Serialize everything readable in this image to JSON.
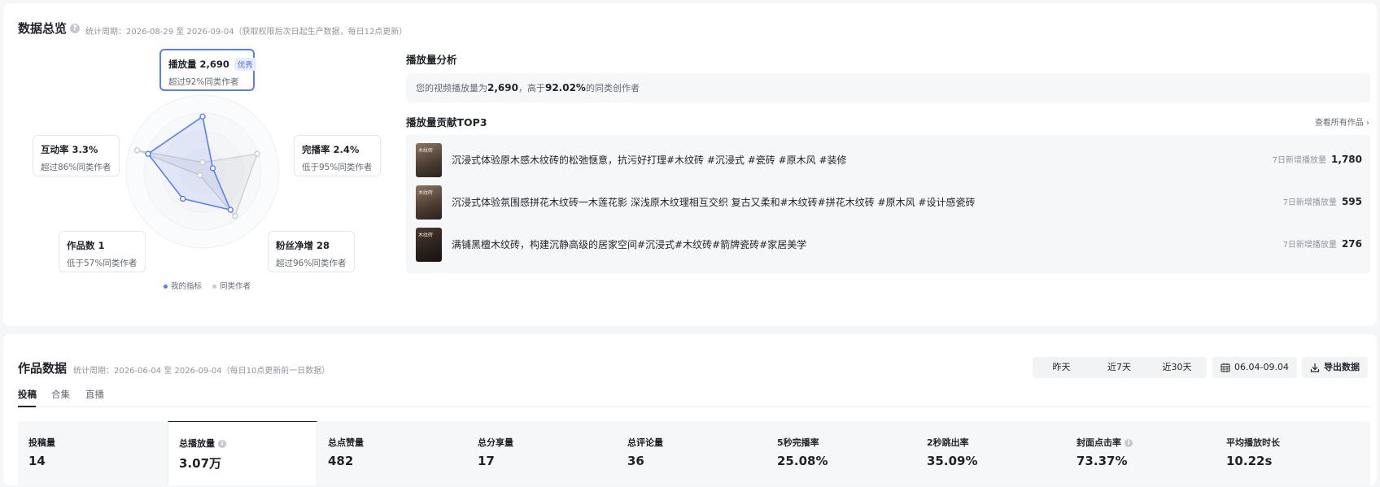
{
  "overview": {
    "title": "数据总览",
    "period": "统计周期：2026-08-29 至 2026-09-04（获取权限后次日起生产数据，每日12点更新）",
    "radar": {
      "play": {
        "title": "播放量 2,690",
        "badge": "优秀",
        "sub": "超过92%同类作者"
      },
      "interact": {
        "title": "互动率 3.3%",
        "sub": "超过86%同类作者"
      },
      "finish": {
        "title": "完播率 2.4%",
        "sub": "低于95%同类作者"
      },
      "works": {
        "title": "作品数 1",
        "sub": "低于57%同类作者"
      },
      "fans": {
        "title": "粉丝净增 28",
        "sub": "超过96%同类作者"
      },
      "legend_mine": "我的指标",
      "legend_peer": "同类作者",
      "mine_color": "#5b7cf4",
      "peer_color": "#c8cbd0",
      "mine_values": [
        0.72,
        0.14,
        0.62,
        0.44,
        0.75
      ],
      "peer_values": [
        0.12,
        0.75,
        0.72,
        0.06,
        0.9
      ]
    },
    "analysis": {
      "title": "播放量分析",
      "text_pre": "您的视频播放量为",
      "value": "2,690",
      "text_mid": "，高于",
      "percent": "92.02%",
      "text_post": "的同类创作者"
    },
    "top3": {
      "title": "播放量贡献TOP3",
      "view_all": "查看所有作品",
      "stat_label": "7日新增播放量",
      "items": [
        {
          "title": "沉浸式体验原木感木纹砖的松弛惬意，抗污好打理#木纹砖 #沉浸式 #瓷砖 #原木风 #装修",
          "value": "1,780"
        },
        {
          "title": "沉浸式体验氛围感拼花木纹砖一木莲花影 深浅原木纹理相互交织 复古又柔和#木纹砖#拼花木纹砖 #原木风 #设计感瓷砖",
          "value": "595"
        },
        {
          "title": "满铺黑檀木纹砖，构建沉静高级的居家空间#沉浸式#木纹砖#箭牌瓷砖#家居美学",
          "value": "276"
        }
      ]
    }
  },
  "works": {
    "title": "作品数据",
    "period": "统计周期：2026-06-04 至 2026-09-04（每日10点更新前一日数据）",
    "ranges": [
      "昨天",
      "近7天",
      "近30天"
    ],
    "date_range": "06.04-09.04",
    "export_label": "导出数据",
    "tabs": [
      "投稿",
      "合集",
      "直播"
    ],
    "metrics": [
      {
        "label": "投稿量",
        "value": "14"
      },
      {
        "label": "总播放量",
        "value": "3.07万"
      },
      {
        "label": "总点赞量",
        "value": "482"
      },
      {
        "label": "总分享量",
        "value": "17"
      },
      {
        "label": "总评论量",
        "value": "36"
      },
      {
        "label": "5秒完播率",
        "value": "25.08%"
      },
      {
        "label": "2秒跳出率",
        "value": "35.09%"
      },
      {
        "label": "封面点击率",
        "value": "73.37%"
      },
      {
        "label": "平均播放时长",
        "value": "10.22s"
      }
    ]
  }
}
